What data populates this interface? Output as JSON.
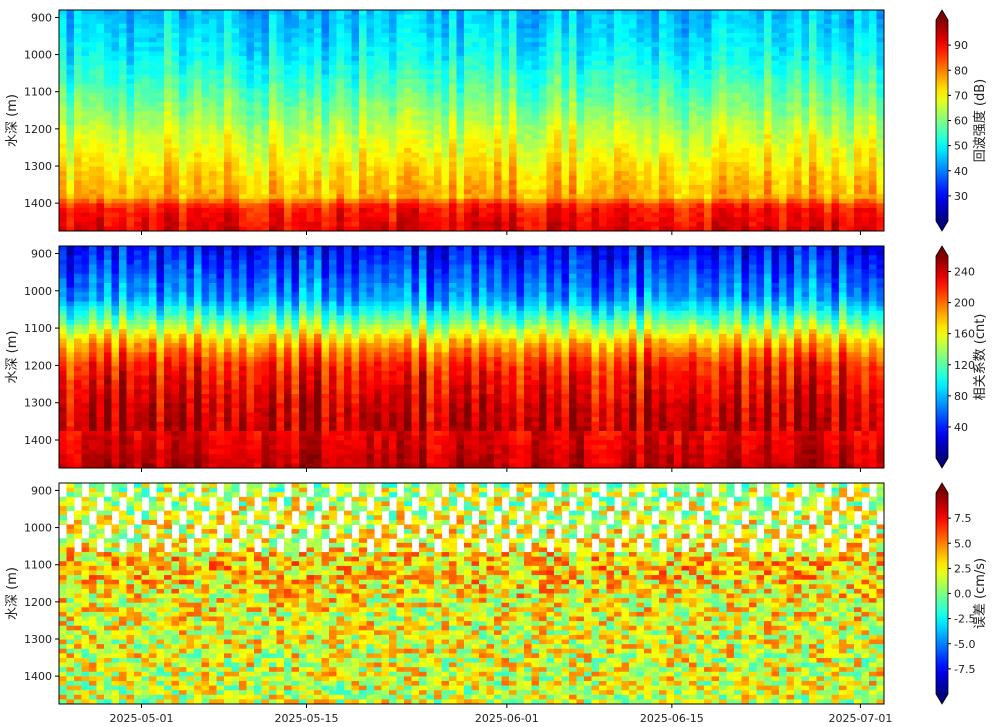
{
  "chart_data": [
    {
      "type": "heatmap",
      "ylabel": "水深 (m)",
      "yticks": [
        "900",
        "1000",
        "1100",
        "1200",
        "1300",
        "1400"
      ],
      "ylim": [
        1475,
        880
      ],
      "xticks": [
        "2025-05-01",
        "2025-05-15",
        "2025-06-01",
        "2025-06-15",
        "2025-07-01"
      ],
      "xlim": [
        "2025-04-24",
        "2025-07-03"
      ],
      "colorbar": {
        "label": "回波强度 (dB)",
        "ticks": [
          "30",
          "40",
          "50",
          "60",
          "70",
          "80",
          "90"
        ],
        "range": [
          20,
          100
        ],
        "extend": "both",
        "colormap": "jet"
      },
      "profile": {
        "depths": [
          880,
          1000,
          1100,
          1200,
          1300,
          1380,
          1410,
          1475
        ],
        "values": [
          43,
          48,
          55,
          63,
          70,
          75,
          88,
          92
        ]
      },
      "show_xticklabels": false
    },
    {
      "type": "heatmap",
      "ylabel": "水深 (m)",
      "yticks": [
        "900",
        "1000",
        "1100",
        "1200",
        "1300",
        "1400"
      ],
      "ylim": [
        1475,
        880
      ],
      "xticks": [
        "2025-05-01",
        "2025-05-15",
        "2025-06-01",
        "2025-06-15",
        "2025-07-01"
      ],
      "xlim": [
        "2025-04-24",
        "2025-07-03"
      ],
      "colorbar": {
        "label": "相关系数 (cnt)",
        "ticks": [
          "40",
          "80",
          "120",
          "160",
          "200",
          "240"
        ],
        "range": [
          0,
          260
        ],
        "extend": "both",
        "colormap": "jet"
      },
      "profile": {
        "depths": [
          880,
          950,
          1020,
          1080,
          1140,
          1200,
          1300,
          1400,
          1475
        ],
        "values": [
          20,
          40,
          60,
          110,
          170,
          205,
          225,
          235,
          245
        ]
      },
      "show_xticklabels": false
    },
    {
      "type": "heatmap",
      "ylabel": "水深 (m)",
      "yticks": [
        "900",
        "1000",
        "1100",
        "1200",
        "1300",
        "1400"
      ],
      "ylim": [
        1475,
        880
      ],
      "xticks": [
        "2025-05-01",
        "2025-05-15",
        "2025-06-01",
        "2025-06-15",
        "2025-07-01"
      ],
      "xlim": [
        "2025-04-24",
        "2025-07-03"
      ],
      "colorbar": {
        "label": "误差 (cm/s)",
        "ticks": [
          "-7.5",
          "-5.0",
          "-2.5",
          "0.0",
          "2.5",
          "5.0",
          "7.5"
        ],
        "range": [
          -10,
          10
        ],
        "extend": "both",
        "colormap": "jet"
      },
      "profile": {
        "depths": [
          880,
          1060,
          1100,
          1200,
          1300,
          1400,
          1475
        ],
        "values": [
          1.0,
          2.5,
          3.5,
          2.5,
          2.0,
          2.0,
          1.5
        ]
      },
      "show_xticklabels": true
    }
  ]
}
